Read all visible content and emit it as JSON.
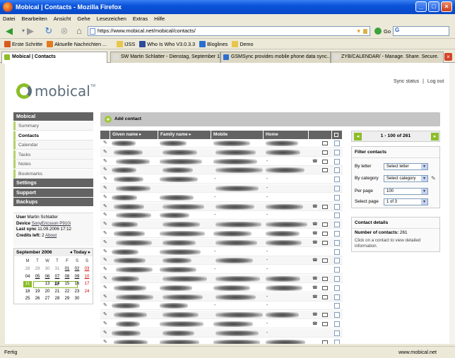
{
  "window": {
    "title": "Mobical | Contacts - Mozilla Firefox"
  },
  "menu": [
    "Datei",
    "Bearbeiten",
    "Ansicht",
    "Gehe",
    "Lesezeichen",
    "Extras",
    "Hilfe"
  ],
  "nav": {
    "url": "https://www.mobical.net/mobical/contacts/",
    "go_label": "Go",
    "search_value": "G"
  },
  "bookmarks": [
    {
      "label": "Erste Schritte",
      "color": "#d95a1e"
    },
    {
      "label": "Aktuelle Nachrichten ...",
      "color": "#e27a1e"
    },
    {
      "label": "IJSS",
      "color": "#e8c64a"
    },
    {
      "label": "Who Is Who V3.0.3.3",
      "color": "#2f4b9a"
    },
    {
      "label": "Bloglines",
      "color": "#2a6fd0"
    },
    {
      "label": "Demo",
      "color": "#e8c64a"
    }
  ],
  "tabs": [
    {
      "label": "Mobical | Contacts",
      "active": true,
      "color": "#8cbd2a"
    },
    {
      "label": "SW Martin Schlatter - Dienstag, September 12 ...",
      "active": false,
      "color": "#dddddd"
    },
    {
      "label": "GSMSync provides mobile phone data sync...",
      "active": false,
      "color": "#2a6fd0"
    },
    {
      "label": "ZYB/CALENDAR/ - Manage. Share. Secure.",
      "active": false,
      "color": "#dddddd"
    }
  ],
  "page": {
    "logo_text": "mobical",
    "logo_tm": "TM",
    "toplinks": {
      "sync_status": "Sync status",
      "separator": "|",
      "logout": "Log out"
    },
    "sidebar": {
      "mobical_head": "Mobical",
      "items": [
        "Summary",
        "Contacts",
        "Calendar",
        "Tasks",
        "Notes",
        "Bookmarks"
      ],
      "active_item": "Contacts",
      "settings": "Settings",
      "support": "Support",
      "backups": "Backups"
    },
    "user": {
      "user_label": "User",
      "user_value": "Martin Schlatter",
      "device_label": "Device",
      "device_value": "SonyEricsson P910i",
      "sync_label": "Last sync",
      "sync_value": "11.09.2006 17:12",
      "credits_label": "Credits left:",
      "credits_value": "2",
      "about": "About"
    },
    "calendar": {
      "title": "September 2006",
      "prev": "◂",
      "today": "Today",
      "next": "▸",
      "days": [
        "M",
        "T",
        "W",
        "T",
        "F",
        "S",
        "S"
      ],
      "weeks": [
        [
          "28",
          "29",
          "30",
          "31",
          "01",
          "02",
          "03"
        ],
        [
          "04",
          "05",
          "06",
          "07",
          "08",
          "09",
          "10"
        ],
        [
          "11",
          "12",
          "13",
          "14",
          "15",
          "16",
          "17"
        ],
        [
          "18",
          "19",
          "20",
          "21",
          "22",
          "23",
          "24"
        ],
        [
          "25",
          "26",
          "27",
          "28",
          "29",
          "30",
          ""
        ]
      ]
    },
    "add_contact": "Add contact",
    "table": {
      "headers": {
        "given": "Given name ▸",
        "family": "Family name ▸",
        "mobile": "Mobile",
        "home": "Home"
      }
    },
    "pager": {
      "prev": "◂",
      "next": "▸",
      "text": "1 - 100 of 261"
    },
    "filter": {
      "title": "Filter contacts",
      "by_letter_label": "By letter",
      "by_letter_value": "Select letter",
      "by_category_label": "By category",
      "by_category_value": "Select category",
      "per_page_label": "Per page",
      "per_page_value": "100",
      "select_page_label": "Select page",
      "select_page_value": "1 of 3"
    },
    "details": {
      "title": "Contact details",
      "count_label": "Number of contacts:",
      "count_value": "261",
      "hint": "Click on a contact to view detailed information."
    }
  },
  "status": {
    "text": "Fertig",
    "url": "www.mobical.net"
  }
}
